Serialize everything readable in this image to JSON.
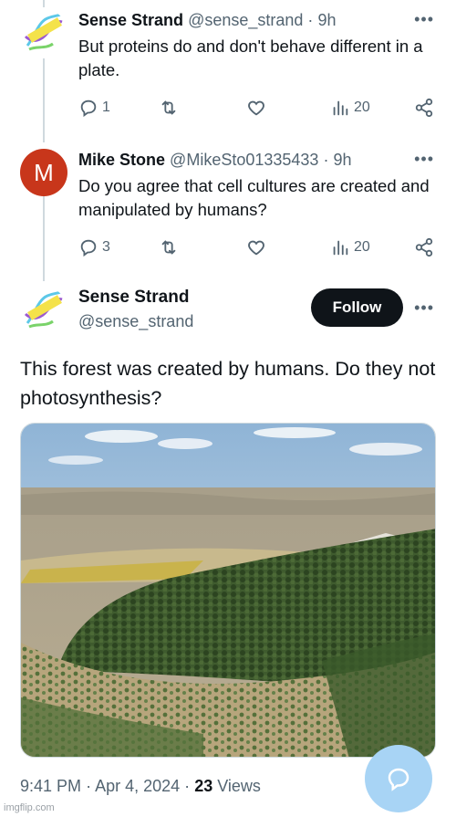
{
  "tweets": [
    {
      "name": "Sense Strand",
      "handle": "@sense_strand",
      "dot": "·",
      "time": "9h",
      "text": "But proteins do and don't behave different in a plate.",
      "replies": "1",
      "views": "20"
    },
    {
      "avatar_letter": "M",
      "name": "Mike Stone",
      "handle": "@MikeSto01335433",
      "dot": "·",
      "time": "9h",
      "text": "Do you agree that cell cultures are created and manipulated by humans?",
      "replies": "3",
      "views": "20"
    }
  ],
  "main_tweet": {
    "name": "Sense Strand",
    "handle": "@sense_strand",
    "follow_label": "Follow",
    "text": "This forest was created by humans. Do they not photosynthesis?",
    "time": "9:41 PM",
    "sep": "·",
    "date": "Apr 4, 2024",
    "sep2": "·",
    "views_count": "23",
    "views_label": "Views"
  },
  "watermark": "imgflip.com",
  "colors": {
    "text": "#0f1419",
    "muted": "#536471",
    "follow_bg": "#0f1419",
    "avatar_m": "#c8361b",
    "fab": "#a8d4f5",
    "thread_line": "#cfd9de"
  },
  "icons": [
    "reply-icon",
    "retweet-icon",
    "like-icon",
    "views-icon",
    "share-icon",
    "more-icon",
    "reply-fab-icon"
  ]
}
